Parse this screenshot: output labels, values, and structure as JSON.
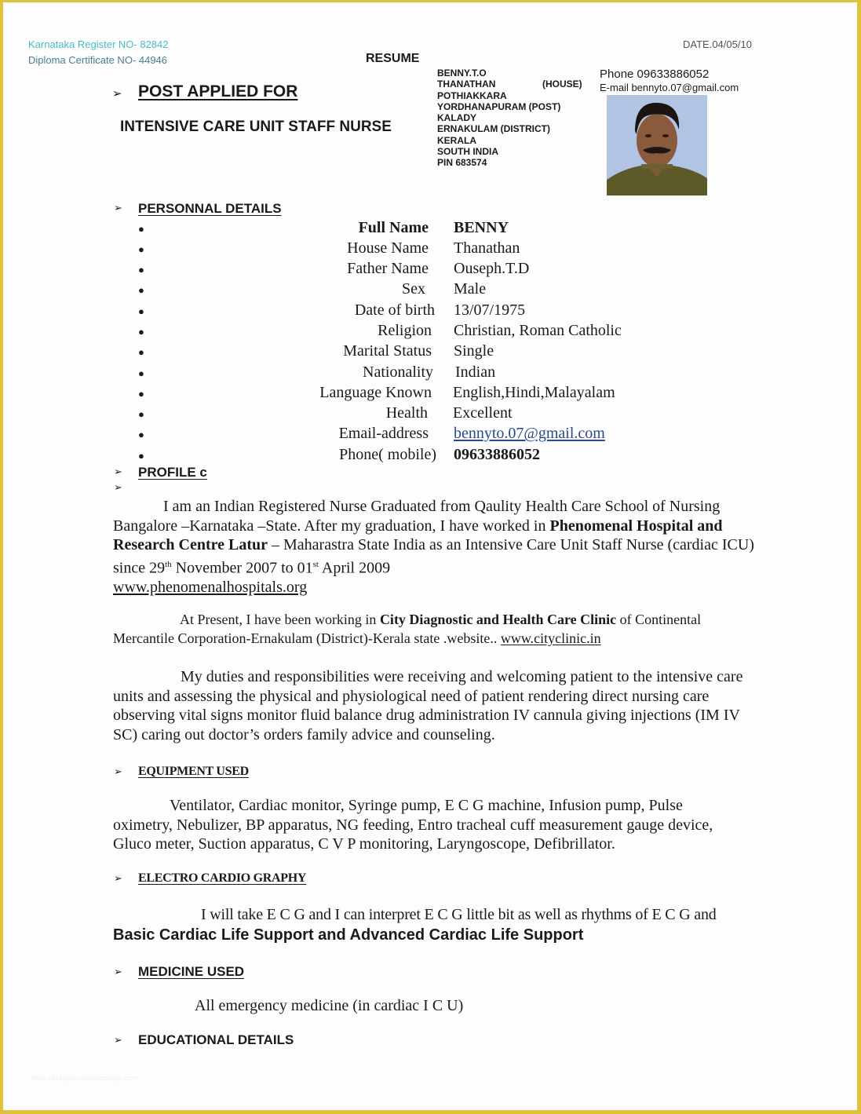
{
  "header": {
    "register_no": "Karnataka Register NO- 82842",
    "diploma_no": "Diploma Certificate NO- 44946",
    "title": "RESUME",
    "date": "DATE.04/05/10"
  },
  "post": {
    "heading": "POST APPLIED FOR",
    "position": "INTENSIVE CARE UNIT STAFF NURSE"
  },
  "address": {
    "lines": [
      "BENNY.T.O",
      "THANATHAN",
      "POTHIAKKARA",
      "YORDHANAPURAM (POST)",
      "KALADY",
      "ERNAKULAM (DISTRICT)",
      "KERALA",
      "SOUTH INDIA",
      "PIN 683574"
    ],
    "house_tag": "(HOUSE)"
  },
  "contact": {
    "phone": "Phone 09633886052",
    "email": "E-mail bennyto.07@gmail.com",
    "photo": "profile-photo"
  },
  "personal_details": {
    "heading": "PERSONNAL DETAILS",
    "rows": [
      {
        "label": "Full Name",
        "value": "BENNY"
      },
      {
        "label": "House Name",
        "value": "Thanathan"
      },
      {
        "label": "Father Name",
        "value": "Ouseph.T.D"
      },
      {
        "label": "Sex",
        "value": "Male"
      },
      {
        "label": "Date of birth",
        "value": "13/07/1975"
      },
      {
        "label": "Religion",
        "value": "Christian, Roman Catholic"
      },
      {
        "label": "Marital Status",
        "value": "Single"
      },
      {
        "label": "Nationality",
        "value": "Indian"
      },
      {
        "label": "Language Known",
        "value": "English,Hindi,Malayalam"
      },
      {
        "label": "Health",
        "value": "Excellent"
      },
      {
        "label": "Email-address",
        "value": "bennyto.07@gmail.com"
      },
      {
        "label": "Phone( mobile)",
        "value": "09633886052"
      }
    ]
  },
  "profile": {
    "heading": "PROFILE c",
    "p1": {
      "t1": "I am an Indian Registered Nurse Graduated from Qaulity Health Care School of Nursing Bangalore –Karnataka –State. After my graduation, I have worked in ",
      "b1": "Phenomenal Hospital and Research Centre Latur",
      "t2": " – Maharastra State India as an Intensive Care Unit Staff Nurse (cardiac ICU) since 29",
      "sup1": "th",
      "t3": " November 2007 to 01",
      "sup2": "st",
      "t4": " April 2009",
      "link": "www.phenomenalhospitals.org"
    },
    "p2": {
      "t1": "At Present, I have been working in ",
      "b1": "City Diagnostic and Health Care Clinic",
      "t2": " of Continental Mercantile Corporation-Ernakulam (District)-Kerala state .website.. ",
      "link": "www.cityclinic.in"
    },
    "p3": "My duties and responsibilities were receiving and welcoming patient to the intensive care units and assessing the physical and physiological need of patient rendering direct nursing care observing vital signs monitor fluid balance drug administration IV cannula giving injections (IM IV SC) caring out doctor’s orders family advice and counseling."
  },
  "equipment": {
    "heading": "EQUIPMENT USED",
    "text": "Ventilator, Cardiac monitor, Syringe pump, E C G machine, Infusion pump, Pulse oximetry, Nebulizer, BP apparatus, NG feeding, Entro tracheal cuff measurement gauge device, Gluco meter, Suction apparatus, C V P monitoring, Laryngoscope, Defibrillator."
  },
  "ecg": {
    "heading": "ELECTRO CARDIO GRAPHY",
    "text": "I will take E C G and I can interpret E C G little bit as well as rhythms of E C G and",
    "bold_text": "Basic Cardiac Life Support and Advanced Cardiac Life Support"
  },
  "medicine": {
    "heading": "MEDICINE USED",
    "text": "All emergency medicine (in cardiac I C U)"
  },
  "education": {
    "heading": "EDUCATIONAL DETAILS"
  },
  "icons": {
    "section_arrow": "➢",
    "bullet": "●"
  },
  "colors": {
    "frame": "#dfc23a",
    "register_text": "#4bbcc4",
    "link": "#2a4a8a"
  },
  "watermark": "www.heritagechristiancollege.com"
}
